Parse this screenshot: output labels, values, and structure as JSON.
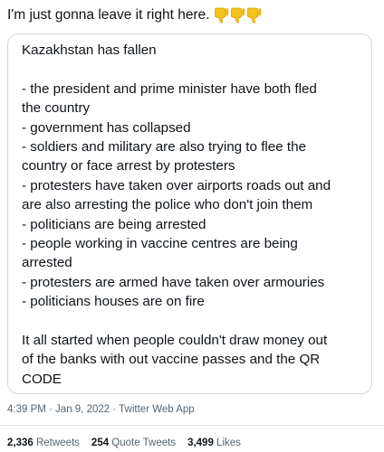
{
  "tweet": {
    "text": "I'm just gonna leave it right here.",
    "emoji": [
      "thumbs-down-icon",
      "thumbs-down-icon",
      "thumbs-down-icon"
    ]
  },
  "quote": {
    "lines": [
      "Kazakhstan has fallen",
      "",
      "- the president and prime minister have both fled",
      "the country",
      "- government has collapsed",
      "- soldiers and military are also trying to flee the",
      "country or face arrest by protesters",
      "- protesters have taken over airports roads out and",
      "are also arresting the police who don't join them",
      "- politicians are being arrested",
      "- people working in vaccine centres are being",
      "arrested",
      "- protesters are armed have taken over armouries",
      "-  politicians houses are on fire",
      "",
      "It all started when people couldn't draw money out",
      "of the banks with out vaccine passes and the QR",
      "CODE"
    ]
  },
  "meta": {
    "timestamp": "4:39 PM · Jan 9, 2022 · Twitter Web App"
  },
  "stats": {
    "retweets_count": "2,336",
    "retweets_label": "Retweets",
    "quotes_count": "254",
    "quotes_label": "Quote Tweets",
    "likes_count": "3,499",
    "likes_label": "Likes"
  },
  "colors": {
    "text": "#0f1419",
    "muted": "#536471",
    "border": "#cfd9de",
    "emoji": "#f4c21c"
  }
}
